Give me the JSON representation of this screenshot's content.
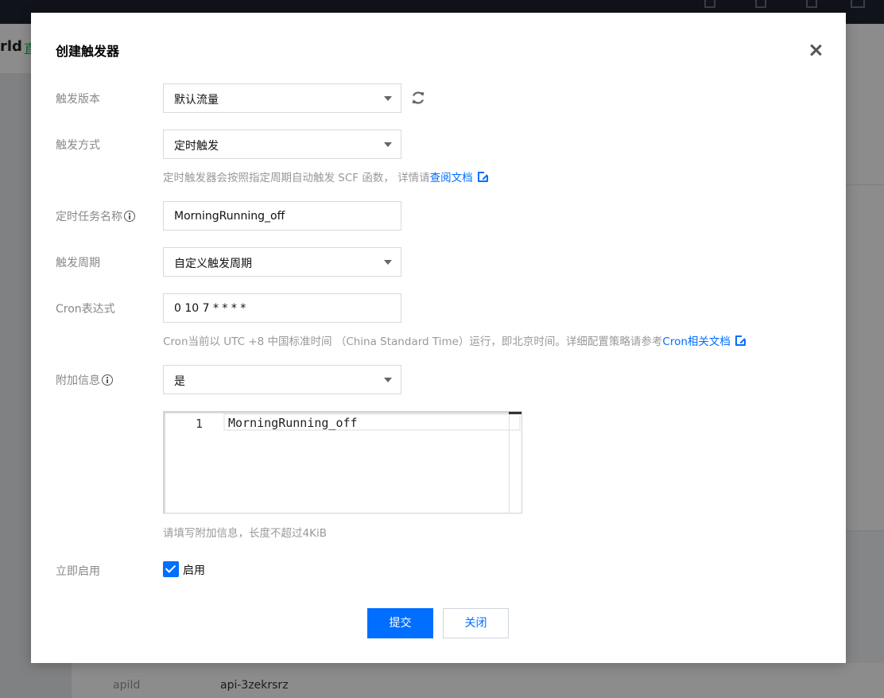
{
  "background": {
    "crumb_fragment": "rld",
    "crumb_tag": "直",
    "bottom_row": {
      "key": "apiId",
      "value": "api-3zekrsrz"
    }
  },
  "dialog": {
    "title": "创建触发器",
    "fields": {
      "version": {
        "label": "触发版本",
        "value": "默认流量"
      },
      "method": {
        "label": "触发方式",
        "value": "定时触发",
        "help": "定时触发器会按照指定周期自动触发 SCF 函数， 详情请",
        "help_link": "查阅文档"
      },
      "task_name": {
        "label": "定时任务名称",
        "value": "MorningRunning_off"
      },
      "period": {
        "label": "触发周期",
        "value": "自定义触发周期"
      },
      "cron": {
        "label": "Cron表达式",
        "value": "0 10 7 * * * *",
        "help": "Cron当前以 UTC +8 中国标准时间 （China Standard Time）运行，即北京时间。详细配置策略请参考",
        "help_link": "Cron相关文档"
      },
      "extra": {
        "label": "附加信息",
        "value": "是",
        "editor_line_number": "1",
        "editor_text": "MorningRunning_off",
        "help": "请填写附加信息，长度不超过4KiB"
      },
      "enable": {
        "label": "立即启用",
        "checkbox_label": "启用",
        "checked": true
      }
    },
    "buttons": {
      "submit": "提交",
      "close": "关闭"
    }
  },
  "colors": {
    "primary": "#006eff",
    "overlay": "rgba(0,0,0,0.45)",
    "label": "#888888",
    "help": "#999999"
  },
  "icons": [
    "close-icon",
    "refresh-icon",
    "caret-down-icon",
    "info-icon",
    "external-link-icon",
    "checkmark-icon"
  ]
}
